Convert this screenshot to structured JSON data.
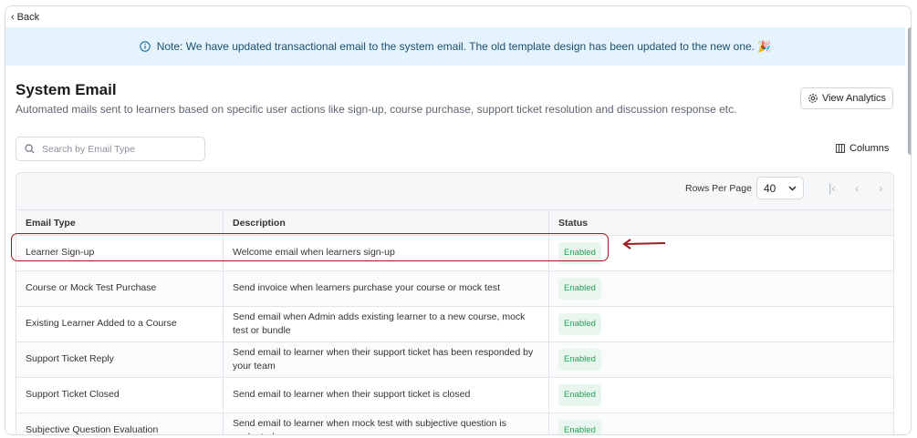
{
  "nav": {
    "back_label": "Back"
  },
  "banner": {
    "text": "Note: We have updated transactional email to the system email. The old template design has been updated to the new one. 🎉"
  },
  "header": {
    "title": "System Email",
    "subtitle": "Automated mails sent to learners based on specific user actions like sign-up, course purchase, support ticket resolution and discussion response etc.",
    "analytics_label": "View Analytics"
  },
  "search": {
    "placeholder": "Search by Email Type",
    "value": ""
  },
  "toolbar": {
    "columns_label": "Columns"
  },
  "pagination": {
    "rows_per_page_label": "Rows Per Page",
    "rows_per_page_value": "40"
  },
  "table": {
    "headers": {
      "type": "Email Type",
      "description": "Description",
      "status": "Status"
    },
    "rows": [
      {
        "type": "Learner Sign-up",
        "description": "Welcome email when learners sign-up",
        "status": "Enabled"
      },
      {
        "type": "Course or Mock Test Purchase",
        "description": "Send invoice when learners purchase your course or mock test",
        "status": "Enabled"
      },
      {
        "type": "Existing Learner Added to a Course",
        "description": "Send email when Admin adds existing learner to a new course, mock test or bundle",
        "status": "Enabled"
      },
      {
        "type": "Support Ticket Reply",
        "description": "Send email to learner when their support ticket has been responded by your team",
        "status": "Enabled"
      },
      {
        "type": "Support Ticket Closed",
        "description": "Send email to learner when their support ticket is closed",
        "status": "Enabled"
      },
      {
        "type": "Subjective Question Evaluation",
        "description": "Send email to learner when mock test with subjective question is evaluated",
        "status": "Enabled"
      }
    ]
  },
  "colors": {
    "banner_bg": "#e4f3fc",
    "badge_text": "#27a05a",
    "badge_bg": "#e8f6ee",
    "annotation": "#9b1c23"
  }
}
